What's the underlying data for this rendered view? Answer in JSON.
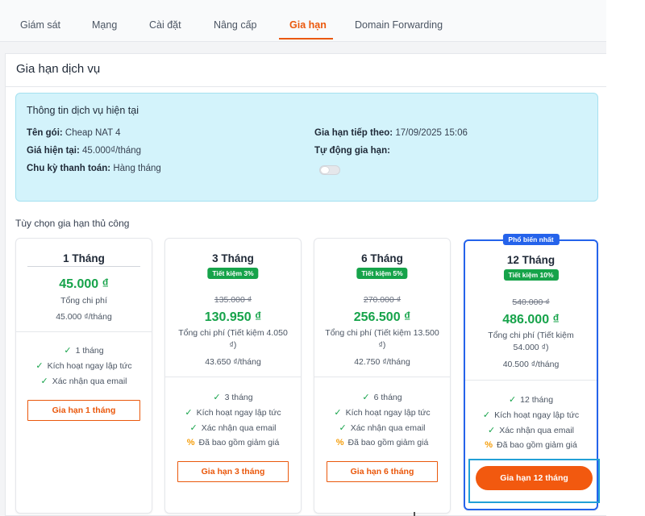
{
  "tabs": [
    {
      "label": "Giám sát"
    },
    {
      "label": "Mạng"
    },
    {
      "label": "Cài đặt"
    },
    {
      "label": "Nâng cấp"
    },
    {
      "label": "Gia hạn"
    },
    {
      "label": "Domain Forwarding"
    }
  ],
  "active_tab": "Gia hạn",
  "panel": {
    "title": "Gia hạn dịch vụ"
  },
  "info": {
    "title": "Thông tin dịch vụ hiện tại",
    "package_label": "Tên gói:",
    "package_value": "Cheap NAT 4",
    "price_label": "Giá hiện tại:",
    "price_value": "45.000₫/tháng",
    "cycle_label": "Chu kỳ thanh toán:",
    "cycle_value": "Hàng tháng",
    "next_label": "Gia hạn tiếp theo:",
    "next_value": "17/09/2025 15:06",
    "auto_label": "Tự động gia hạn:",
    "auto_renew_on": false
  },
  "section_label": "Tùy chọn gia hạn thủ công",
  "plans": [
    {
      "title": "1 Tháng",
      "price": "45.000 ₫",
      "total": "Tổng chi phí",
      "monthly": "45.000 ₫/tháng",
      "features": [
        "1 tháng",
        "Kích hoạt ngay lập tức",
        "Xác nhận qua email"
      ],
      "button": "Gia hạn 1 tháng"
    },
    {
      "title": "3 Tháng",
      "badge": "Tiết kiệm 3%",
      "old_price": "135.000 ₫",
      "price": "130.950 ₫",
      "total": "Tổng chi phí (Tiết kiệm 4.050 ₫)",
      "monthly": "43.650 ₫/tháng",
      "features": [
        "3 tháng",
        "Kích hoạt ngay lập tức",
        "Xác nhận qua email",
        "Đã bao gồm giảm giá"
      ],
      "button": "Gia hạn 3 tháng"
    },
    {
      "title": "6 Tháng",
      "badge": "Tiết kiệm 5%",
      "old_price": "270.000 ₫",
      "price": "256.500 ₫",
      "total": "Tổng chi phí (Tiết kiệm 13.500 ₫)",
      "monthly": "42.750 ₫/tháng",
      "features": [
        "6 tháng",
        "Kích hoạt ngay lập tức",
        "Xác nhận qua email",
        "Đã bao gồm giảm giá"
      ],
      "button": "Gia hạn 6 tháng"
    },
    {
      "title": "12 Tháng",
      "popular": "Phổ biến nhất",
      "badge": "Tiết kiệm 10%",
      "old_price": "540.000 ₫",
      "price": "486.000 ₫",
      "total": "Tổng chi phí (Tiết kiệm 54.000 ₫)",
      "monthly": "40.500 ₫/tháng",
      "features": [
        "12 tháng",
        "Kích hoạt ngay lập tức",
        "Xác nhận qua email",
        "Đã bao gồm giảm giá"
      ],
      "button": "Gia hạn 12 tháng"
    }
  ],
  "colors": {
    "accent": "#ea580c",
    "primary_button": "#f2590f",
    "price_green": "#16a34a",
    "popular_blue": "#2563eb",
    "info_bg": "#d3f3fb"
  },
  "icons": {
    "feature": "check-icon",
    "discount": "percent-icon"
  }
}
